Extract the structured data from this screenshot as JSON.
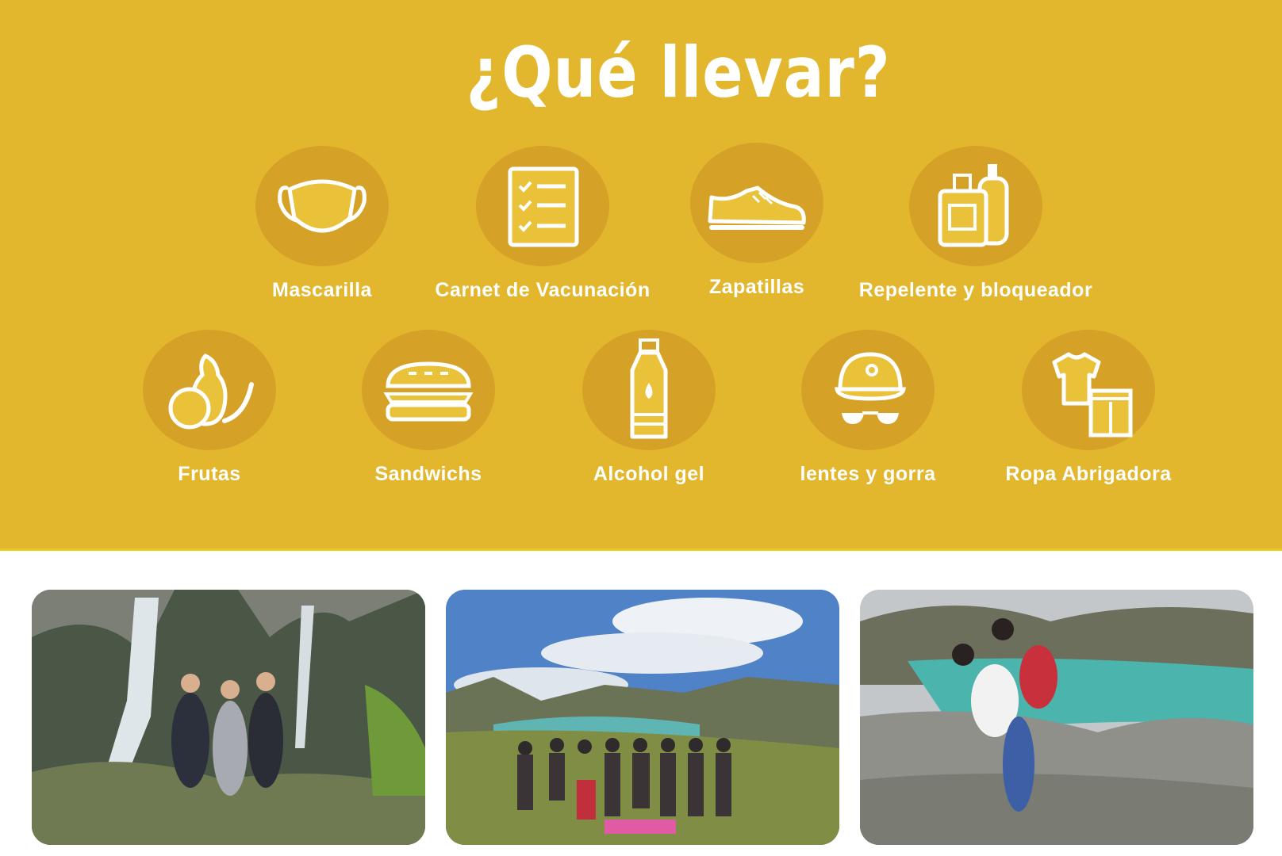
{
  "header": {
    "title": "¿Qué llevar?"
  },
  "colors": {
    "banner": "#e2b72d",
    "circle": "#d5a227",
    "icon_fill": "#e9c23a",
    "text": "#ffffff"
  },
  "items": [
    {
      "label": "Mascarilla",
      "icon": "face-mask-icon"
    },
    {
      "label": "Carnet de Vacunación",
      "icon": "checklist-icon"
    },
    {
      "label": "Zapatillas",
      "icon": "sneaker-icon"
    },
    {
      "label": "Repelente y bloqueador",
      "icon": "lotion-bottles-icon"
    },
    {
      "label": "Frutas",
      "icon": "fruits-icon"
    },
    {
      "label": "Sandwichs",
      "icon": "sandwich-icon"
    },
    {
      "label": "Alcohol gel",
      "icon": "water-bottle-icon"
    },
    {
      "label": "lentes y gorra",
      "icon": "cap-and-sunglasses-icon"
    },
    {
      "label": "Ropa Abrigadora",
      "icon": "clothes-icon"
    }
  ]
}
